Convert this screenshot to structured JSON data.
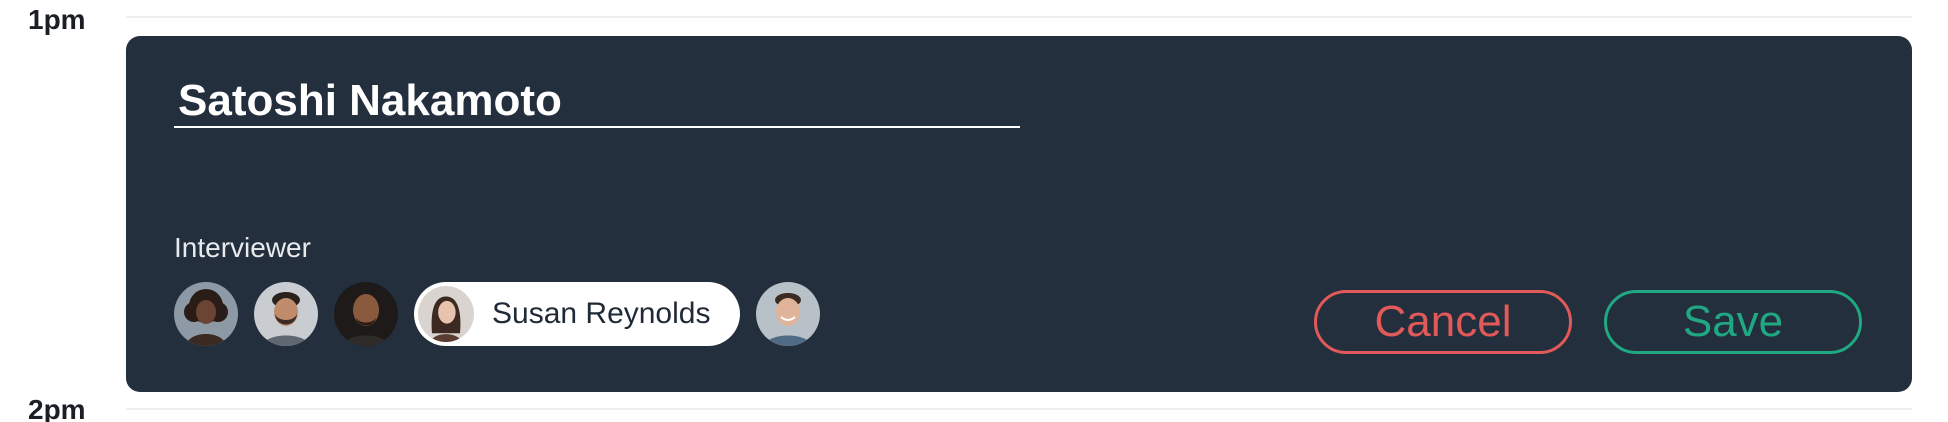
{
  "timeline": {
    "top_label": "1pm",
    "bottom_label": "2pm"
  },
  "editor": {
    "candidate_name": "Satoshi Nakamoto",
    "interviewer_label": "Interviewer",
    "interviewers": [
      {
        "icon": "avatar-woman-curly-hair"
      },
      {
        "icon": "avatar-man-beard"
      },
      {
        "icon": "avatar-man-bald"
      },
      {
        "icon": "avatar-man-smiling"
      }
    ],
    "selected_interviewer": {
      "name": "Susan Reynolds",
      "icon": "avatar-woman-long-hair"
    },
    "cancel_label": "Cancel",
    "save_label": "Save"
  },
  "colors": {
    "card_background": "#232f3d",
    "cancel": "#e15959",
    "save": "#1fa882",
    "text_light": "#ffffff"
  }
}
